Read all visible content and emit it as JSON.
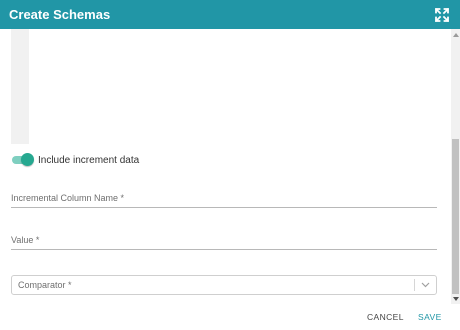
{
  "dialog": {
    "title": "Create Schemas"
  },
  "form": {
    "include_increment_label": "Include increment data",
    "include_increment_enabled": true,
    "incremental_column_label": "Incremental Column Name *",
    "value_label": "Value *",
    "comparator_placeholder": "Comparator *"
  },
  "footer": {
    "cancel_label": "CANCEL",
    "save_label": "SAVE"
  },
  "colors": {
    "header": "#2196a6",
    "toggle_on": "#26a890",
    "save": "#2196a6"
  },
  "icons": {
    "header": "expand-icon",
    "select": "chevron-down-icon"
  }
}
